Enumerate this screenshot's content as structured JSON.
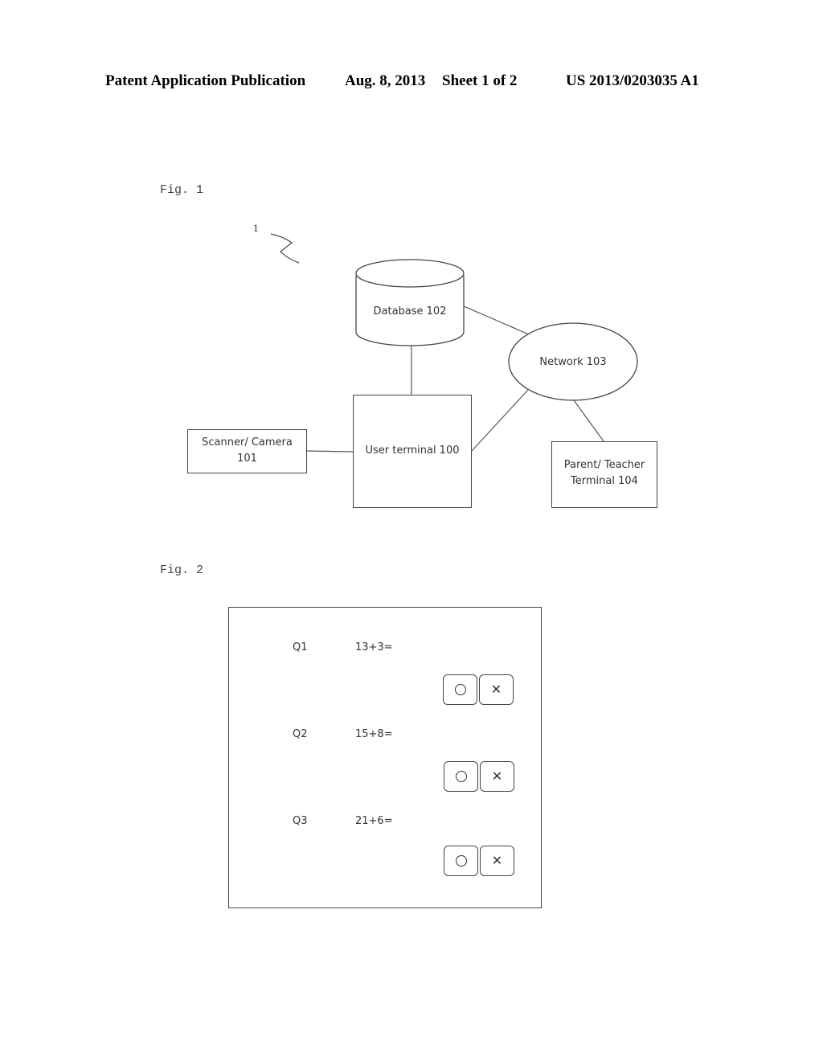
{
  "header": {
    "publication": "Patent Application Publication",
    "date": "Aug. 8, 2013",
    "sheet": "Sheet 1 of 2",
    "patent_number": "US 2013/0203035 A1"
  },
  "fig1": {
    "label": "Fig. 1",
    "reference_numeral": "1",
    "nodes": {
      "database": "Database 102",
      "network": "Network 103",
      "user_terminal": "User terminal 100",
      "scanner_line1": "Scanner/ Camera",
      "scanner_line2": "101",
      "parent_line1": "Parent/ Teacher",
      "parent_line2": "Terminal 104"
    }
  },
  "fig2": {
    "label": "Fig. 2",
    "questions": [
      {
        "id": "Q1",
        "expression": "13+3=",
        "correct_icon": "circle-icon",
        "wrong_icon": "cross-icon",
        "wrong_glyph": "✕"
      },
      {
        "id": "Q2",
        "expression": "15+8=",
        "correct_icon": "circle-icon",
        "wrong_icon": "cross-icon",
        "wrong_glyph": "✕"
      },
      {
        "id": "Q3",
        "expression": "21+6=",
        "correct_icon": "circle-icon",
        "wrong_icon": "cross-icon",
        "wrong_glyph": "✕"
      }
    ]
  }
}
